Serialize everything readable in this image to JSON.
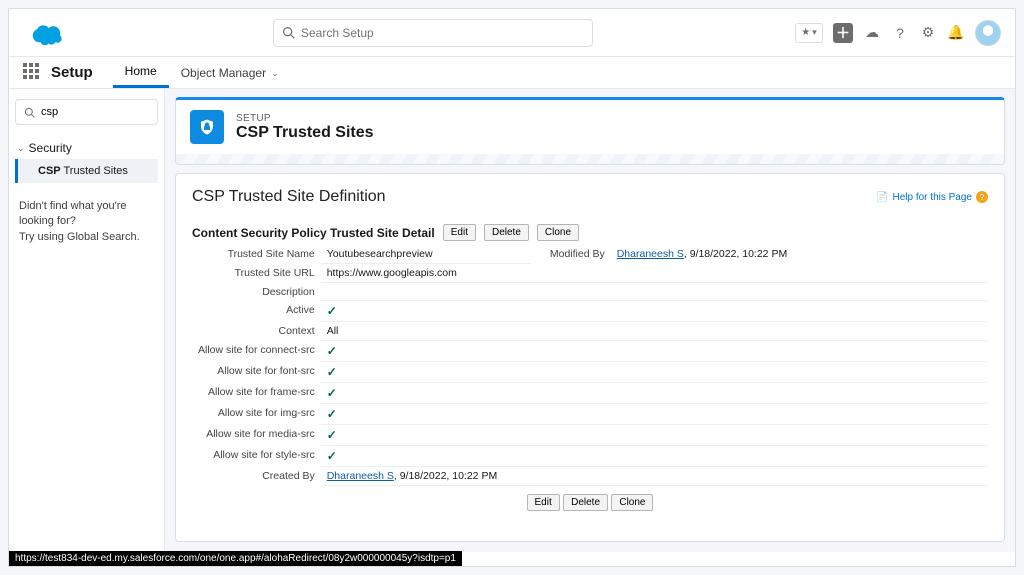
{
  "topbar": {
    "search_placeholder": "Search Setup"
  },
  "tabs": {
    "setup_label": "Setup",
    "home": "Home",
    "object_manager": "Object Manager"
  },
  "sidebar": {
    "search_value": "csp",
    "tree_header": "Security",
    "item_prefix": "CSP",
    "item_suffix": " Trusted Sites",
    "notfound_l1": "Didn't find what you're looking for?",
    "notfound_l2": "Try using Global Search."
  },
  "page_header": {
    "eyebrow": "SETUP",
    "title": "CSP Trusted Sites"
  },
  "classic": {
    "page_title": "CSP Trusted Site Definition",
    "help_link": "Help for this Page",
    "section_title": "Content Security Policy Trusted Site Detail",
    "buttons": {
      "edit": "Edit",
      "delete": "Delete",
      "clone": "Clone"
    },
    "fields": {
      "trusted_site_name": {
        "label": "Trusted Site Name",
        "value": "Youtubesearchpreview"
      },
      "trusted_site_url": {
        "label": "Trusted Site URL",
        "value": "https://www.googleapis.com"
      },
      "description": {
        "label": "Description",
        "value": ""
      },
      "active": {
        "label": "Active",
        "checked": true
      },
      "context": {
        "label": "Context",
        "value": "All"
      },
      "connect_src": {
        "label": "Allow site for connect-src",
        "checked": true
      },
      "font_src": {
        "label": "Allow site for font-src",
        "checked": true
      },
      "frame_src": {
        "label": "Allow site for frame-src",
        "checked": true
      },
      "img_src": {
        "label": "Allow site for img-src",
        "checked": true
      },
      "media_src": {
        "label": "Allow site for media-src",
        "checked": true
      },
      "style_src": {
        "label": "Allow site for style-src",
        "checked": true
      },
      "created_by": {
        "label": "Created By",
        "user": "Dharaneesh S",
        "ts": "9/18/2022, 10:22 PM"
      },
      "modified_by": {
        "label": "Modified By",
        "user": "Dharaneesh S",
        "ts": "9/18/2022, 10:22 PM"
      }
    }
  },
  "statusbar": "https://test834-dev-ed.my.salesforce.com/one/one.app#/alohaRedirect/08y2w000000045y?isdtp=p1"
}
